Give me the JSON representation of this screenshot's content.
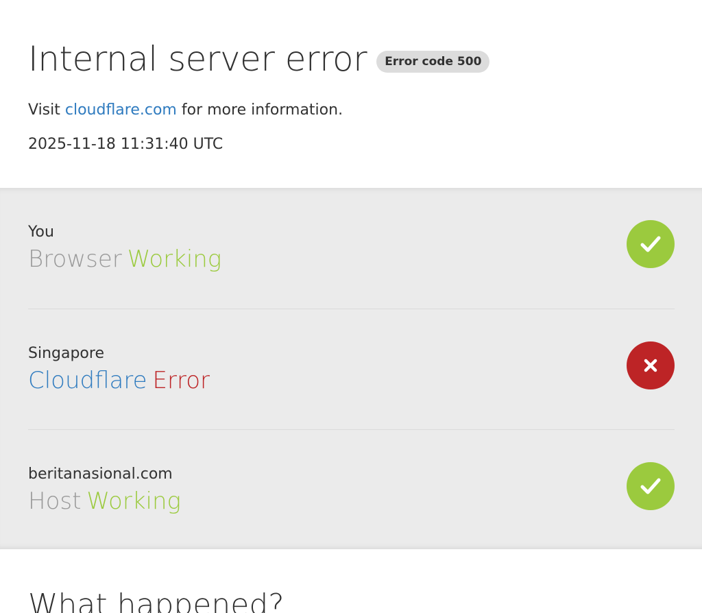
{
  "header": {
    "title": "Internal server error",
    "error_badge": "Error code 500",
    "visit_prefix": "Visit ",
    "visit_link": "cloudflare.com",
    "visit_suffix": " for more information.",
    "timestamp": "2025-11-18 11:31:40 UTC"
  },
  "status": [
    {
      "location": "You",
      "type": "Browser",
      "state": "Working",
      "icon": "check-icon",
      "color": "#9bca3e"
    },
    {
      "location": "Singapore",
      "type": "Cloudflare",
      "state": "Error",
      "icon": "cross-icon",
      "color": "#bd2426"
    },
    {
      "location": "beritanasional.com",
      "type": "Host",
      "state": "Working",
      "icon": "check-icon",
      "color": "#9bca3e"
    }
  ],
  "section": {
    "heading": "What happened?"
  },
  "colors": {
    "link": "#2f7bbf",
    "ok": "#9bca3e",
    "error": "#bd2426",
    "panel_bg": "#ebebeb"
  }
}
